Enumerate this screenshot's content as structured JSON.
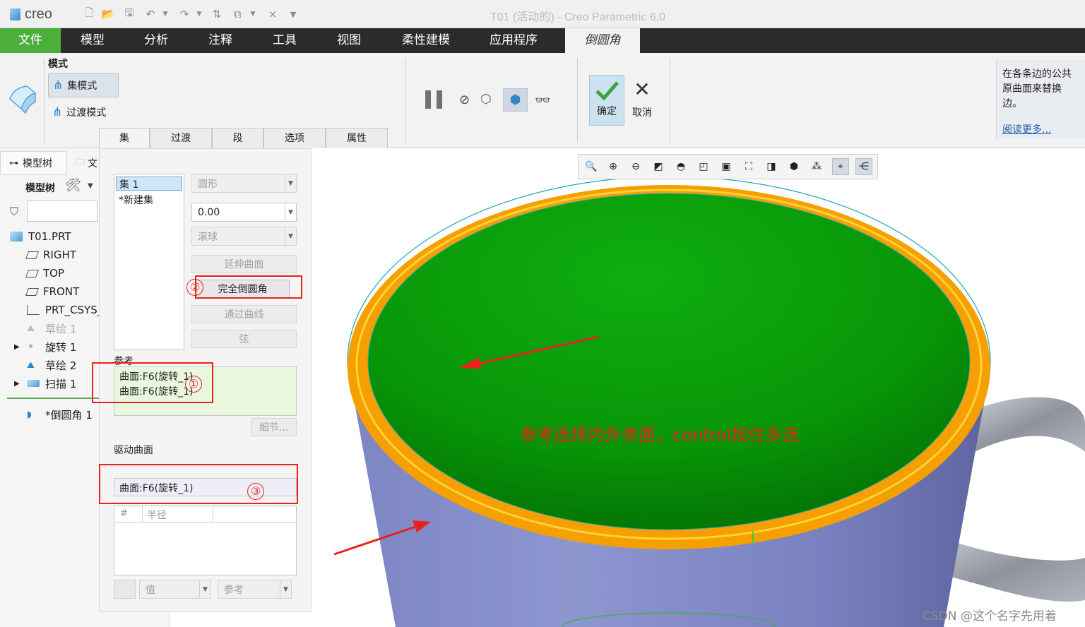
{
  "app": {
    "logo": "creo",
    "window_title": "T01 (活动的) - Creo Parametric 6.0"
  },
  "quick_access": [
    "new-icon",
    "open-icon",
    "save-icon",
    "undo-icon",
    "dropdown-icon",
    "redo-icon",
    "dropdown-icon",
    "regenerate-icon",
    "windows-icon",
    "dropdown-icon",
    "close-window-icon",
    "customize-icon"
  ],
  "tabs": [
    "文件",
    "模型",
    "分析",
    "注释",
    "工具",
    "视图",
    "柔性建模",
    "应用程序",
    "倒圆角"
  ],
  "ribbon": {
    "mode_label": "模式",
    "set_mode": "集模式",
    "transition_mode": "过渡模式",
    "ok": "确定",
    "cancel": "取消",
    "subtabs": [
      "集",
      "过渡",
      "段",
      "选项",
      "属性"
    ]
  },
  "help": {
    "text": "在各条边的公共原曲面来替换边。",
    "link": "阅读更多..."
  },
  "left_panel": {
    "tab_model_tree": "模型树",
    "tab_other": "文",
    "tree_header": "模型树",
    "items": [
      {
        "label": "T01.PRT",
        "icon": "part-icon"
      },
      {
        "label": "RIGHT",
        "icon": "plane-icon"
      },
      {
        "label": "TOP",
        "icon": "plane-icon"
      },
      {
        "label": "FRONT",
        "icon": "plane-icon"
      },
      {
        "label": "PRT_CSYS_",
        "icon": "csys-icon"
      },
      {
        "label": "草绘 1",
        "icon": "sketch-icon"
      },
      {
        "label": "旋转 1",
        "icon": "revolve-icon"
      },
      {
        "label": "草绘 2",
        "icon": "sketch-icon"
      },
      {
        "label": "扫描 1",
        "icon": "sweep-icon"
      },
      {
        "label": "*倒圆角 1",
        "icon": "round-icon"
      }
    ]
  },
  "sets_panel": {
    "sets": [
      "集 1",
      "*新建集"
    ],
    "shape": "圆形",
    "radius_value": "0.00",
    "method": "滚球",
    "btn_extend": "延伸曲面",
    "btn_full_round": "完全倒圆角",
    "btn_through_curve": "通过曲线",
    "btn_chord": "弦",
    "references_label": "参考",
    "references": [
      "曲面:F6(旋转_1)",
      "曲面:F6(旋转_1)"
    ],
    "details_button": "细节...",
    "driving_surface_label": "驱动曲面",
    "driving_surface": "曲面:F6(旋转_1)",
    "radius_table_headers": [
      "#",
      "半径"
    ],
    "value_select": "值",
    "reference_select": "参考"
  },
  "annotations": {
    "circle1": "①",
    "circle2": "②",
    "circle3": "③",
    "note": "参考选择内外表面，control按住多选"
  },
  "watermark": "CSDN @这个名字先用着",
  "colors": {
    "accent_green": "#4caf3c",
    "annotation_red": "#e8221d",
    "selected_surface": "#0a8c0a",
    "highlight_edge": "#f5a000"
  }
}
